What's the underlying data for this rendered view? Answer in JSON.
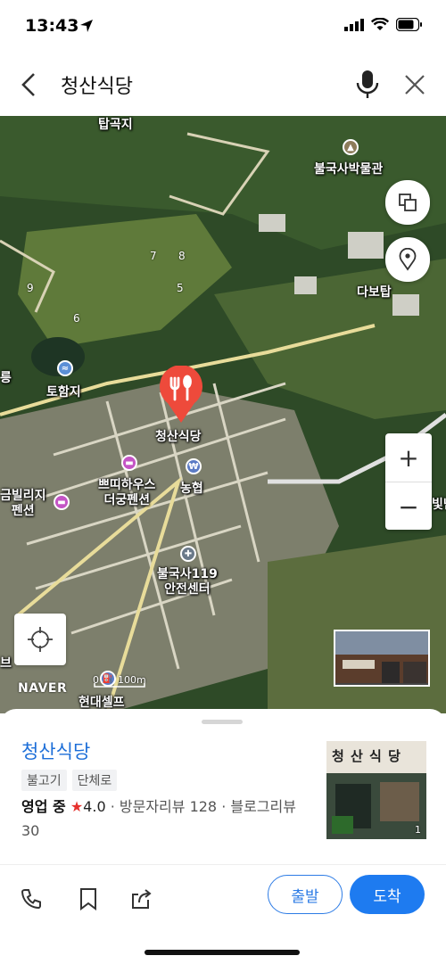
{
  "status_bar": {
    "time": "13:43"
  },
  "search": {
    "query": "청산식당"
  },
  "map": {
    "labels": {
      "tapgokji": "탑곡지",
      "museum": "불국사박물관",
      "dabotap": "다보탑",
      "tohamji": "토함지",
      "place": "청산식당",
      "guesthouse": "쁘띠하우스\n더궁펜션",
      "nonghyup": "농협",
      "geumbilliji": "금빌리지\n펜션",
      "fire_station": "불국사119\n안전센터",
      "hyundai": "현대셀프",
      "edge_left_1": "릉",
      "edge_left_2": "브",
      "edge_right_1": "빛난"
    },
    "hole_numbers": [
      "7",
      "8",
      "9",
      "5",
      "6"
    ],
    "brand": "NAVER",
    "scale": {
      "zero": "0",
      "distance": "100m"
    },
    "zoom_in": "+",
    "zoom_out": "−"
  },
  "place": {
    "name": "청산식당",
    "tags": [
      "불고기",
      "단체로"
    ],
    "open_status": "영업 중",
    "star": "★",
    "rating": "4.0",
    "reviews_text": "· 방문자리뷰 128 · 블로그리뷰 30",
    "photo_count": "1",
    "photo_sign": "청 산 식 당"
  },
  "actions": {
    "depart": "출발",
    "arrive": "도착"
  },
  "icons": [
    "location-arrow-icon",
    "signal-icon",
    "wifi-icon",
    "battery-icon",
    "back-icon",
    "mic-icon",
    "close-icon",
    "layers-icon",
    "location-pin-icon",
    "gps-icon",
    "phone-icon",
    "bookmark-icon",
    "share-icon",
    "fork-knife-icon"
  ],
  "colors": {
    "accent": "#1e7bf0",
    "place_name": "#1c6ed8",
    "pin": "#ee4a3b",
    "star": "#e6312d"
  }
}
